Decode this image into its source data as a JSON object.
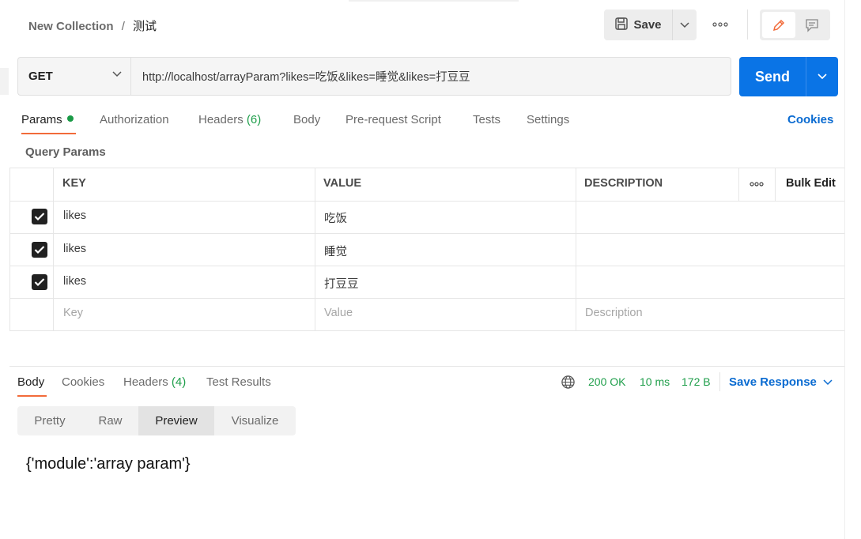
{
  "header": {
    "collection": "New Collection",
    "separator": "/",
    "request_name": "测试",
    "save_label": "Save"
  },
  "request": {
    "method": "GET",
    "url": "http://localhost/arrayParam?likes=吃饭&likes=睡觉&likes=打豆豆",
    "send_label": "Send"
  },
  "tabs": {
    "params": "Params",
    "authorization": "Authorization",
    "headers": "Headers",
    "headers_count": "(6)",
    "body": "Body",
    "prerequest": "Pre-request Script",
    "tests": "Tests",
    "settings": "Settings",
    "cookies": "Cookies"
  },
  "query_params": {
    "title": "Query Params",
    "columns": {
      "key": "KEY",
      "value": "VALUE",
      "description": "DESCRIPTION",
      "bulk_edit": "Bulk Edit"
    },
    "rows": [
      {
        "checked": true,
        "key": "likes",
        "value": "吃饭",
        "description": ""
      },
      {
        "checked": true,
        "key": "likes",
        "value": "睡觉",
        "description": ""
      },
      {
        "checked": true,
        "key": "likes",
        "value": "打豆豆",
        "description": ""
      }
    ],
    "placeholders": {
      "key": "Key",
      "value": "Value",
      "description": "Description"
    }
  },
  "response": {
    "tabs": {
      "body": "Body",
      "cookies": "Cookies",
      "headers": "Headers",
      "headers_count": "(4)",
      "test_results": "Test Results"
    },
    "status": "200 OK",
    "time": "10 ms",
    "size": "172 B",
    "save_response": "Save Response",
    "views": {
      "pretty": "Pretty",
      "raw": "Raw",
      "preview": "Preview",
      "visualize": "Visualize"
    },
    "active_view": "Preview",
    "body_text": "{'module':'array param'}"
  },
  "colors": {
    "accent": "#f26b3a",
    "send": "#0a74e6",
    "link": "#0a6bd1",
    "success": "#1e9e4a"
  }
}
